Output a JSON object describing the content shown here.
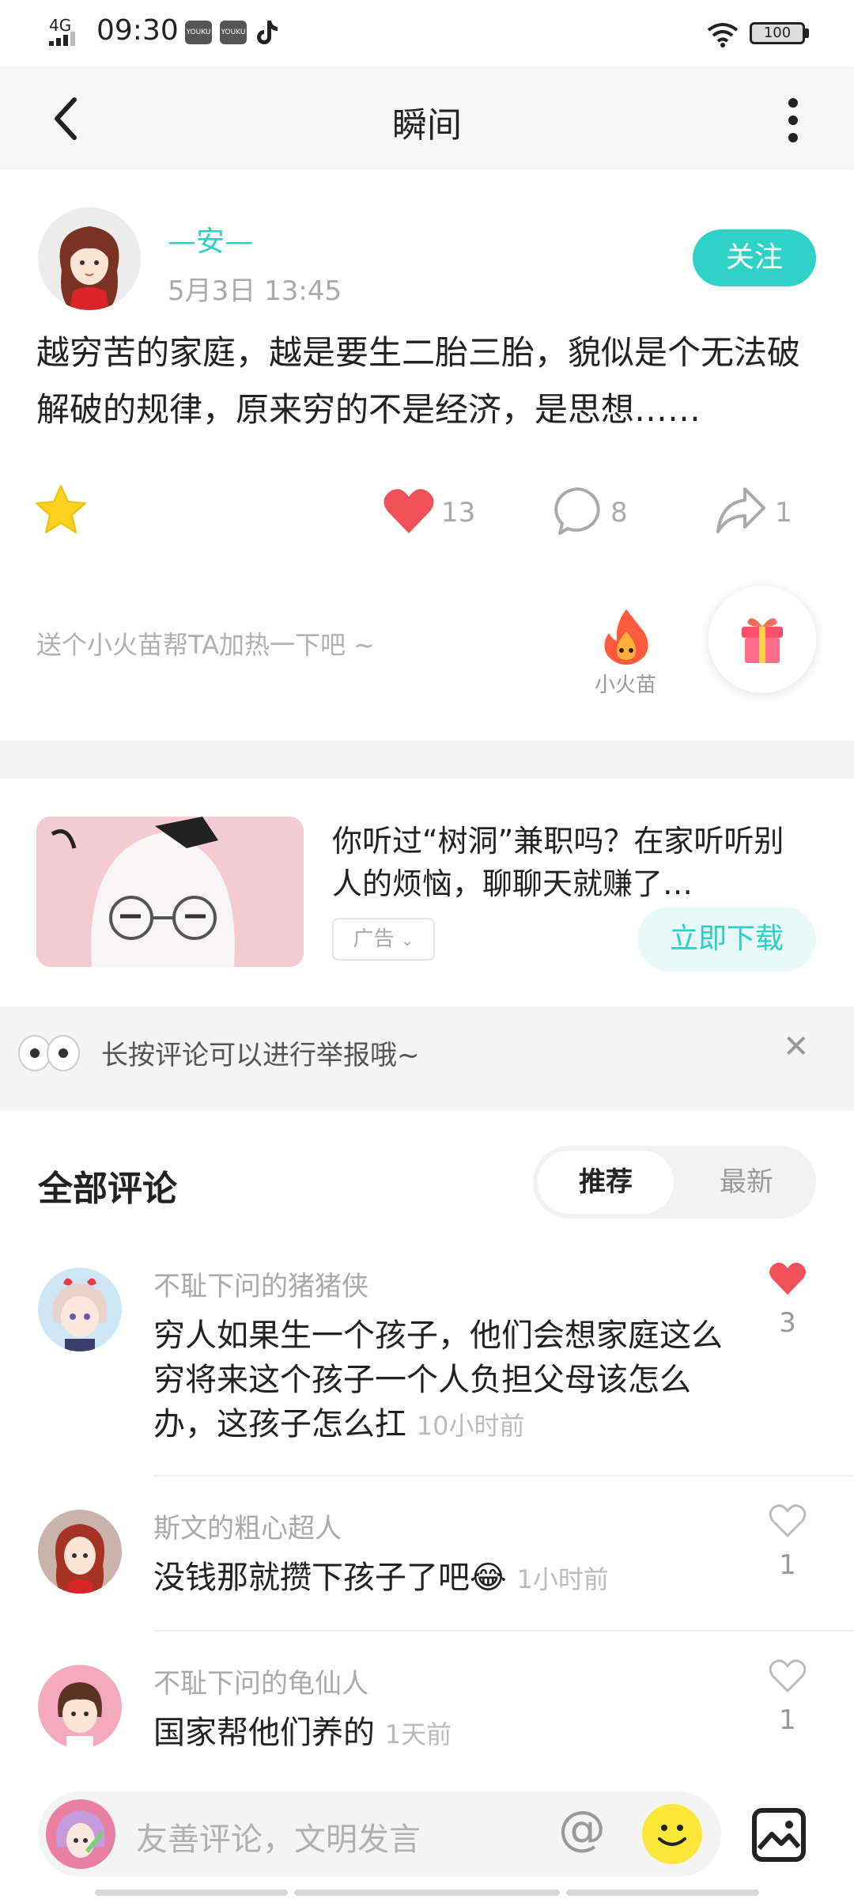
{
  "status_bar": {
    "network": "4G",
    "time": "09:30",
    "app_badge_1": "YOUKU",
    "app_badge_2": "YOUKU",
    "battery": "100"
  },
  "nav": {
    "title": "瞬间"
  },
  "post": {
    "username": "—安—",
    "time": "5月3日 13:45",
    "follow_label": "关注",
    "text": "越穷苦的家庭，越是要生二胎三胎，貌似是个无法破解破的规律，原来穷的不是经济，是思想……",
    "like_count": "13",
    "comment_count": "8",
    "share_count": "1",
    "heat_prompt": "送个小火苗帮TA加热一下吧 ~",
    "flame_label": "小火苗"
  },
  "ad": {
    "text": "你听过“树洞”兼职吗？在家听听别人的烦恼，聊聊天就赚了…",
    "tag": "广告",
    "download_label": "立即下载"
  },
  "notice": {
    "text": "长按评论可以进行举报哦~"
  },
  "comments": {
    "title": "全部评论",
    "sort_recommended": "推荐",
    "sort_latest": "最新",
    "items": [
      {
        "name": "不耻下问的猪猪侠",
        "text": "穷人如果生一个孩子，他们会想家庭这么穷将来这个孩子一个人负担父母该怎么办，这孩子怎么扛",
        "time": "10小时前",
        "likes": "3"
      },
      {
        "name": "斯文的粗心超人",
        "text": "没钱那就攒下孩子了吧😂",
        "time": "1小时前",
        "likes": "1"
      },
      {
        "name": "不耻下问的龟仙人",
        "text": "国家帮他们养的",
        "time": "1天前",
        "likes": "1"
      }
    ]
  },
  "input": {
    "placeholder": "友善评论，文明发言",
    "at": "@"
  },
  "colors": {
    "accent": "#2fd2c7",
    "like_red": "#f0505a",
    "star_yellow": "#ffd21f"
  }
}
